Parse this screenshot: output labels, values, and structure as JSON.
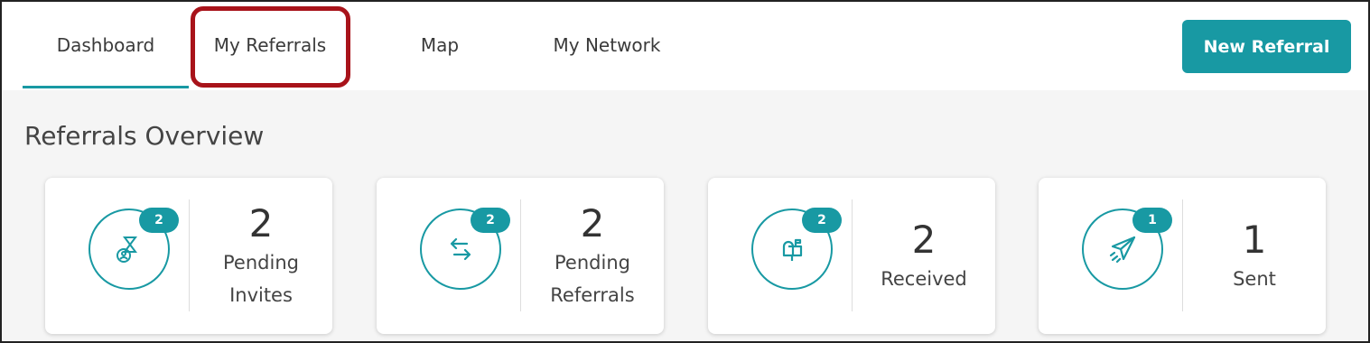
{
  "nav": {
    "tabs": [
      {
        "label": "Dashboard",
        "active": true
      },
      {
        "label": "My Referrals",
        "highlighted": true
      },
      {
        "label": "Map"
      },
      {
        "label": "My Network"
      }
    ],
    "new_referral_label": "New Referral"
  },
  "overview": {
    "title": "Referrals Overview",
    "cards": [
      {
        "badge": "2",
        "value": "2",
        "label_line1": "Pending",
        "label_line2": "Invites",
        "icon": "pending-invites-icon"
      },
      {
        "badge": "2",
        "value": "2",
        "label_line1": "Pending",
        "label_line2": "Referrals",
        "icon": "exchange-arrows-icon"
      },
      {
        "badge": "2",
        "value": "2",
        "label": "Received",
        "icon": "mailbox-icon"
      },
      {
        "badge": "1",
        "value": "1",
        "label": "Sent",
        "icon": "paper-plane-icon"
      }
    ]
  },
  "colors": {
    "accent": "#1899a3",
    "highlight": "#a8131a"
  }
}
